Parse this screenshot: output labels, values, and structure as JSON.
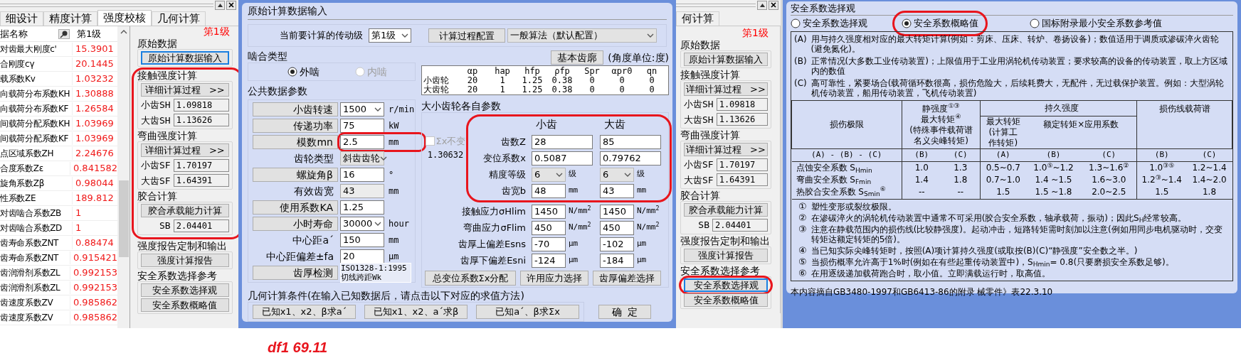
{
  "strength_panel": {
    "tabs": [
      {
        "label": "细设计",
        "selected": false
      },
      {
        "label": "精度计算",
        "selected": false
      },
      {
        "label": "强度校核",
        "selected": true
      },
      {
        "label": "几何计算",
        "selected": false
      }
    ],
    "table": {
      "columns": [
        "据名称",
        "第1级"
      ],
      "rows": [
        {
          "name": "对齿最大刚度c'",
          "value": "15.3901"
        },
        {
          "name": "合刚度cγ",
          "value": "20.1445"
        },
        {
          "name": "载系数Kv",
          "value": "1.03232"
        },
        {
          "name": "向载荷分布系数KH",
          "value": "1.30888"
        },
        {
          "name": "向载荷分布系数KF",
          "value": "1.26584"
        },
        {
          "name": "间载荷分配系数KH",
          "value": "1.03969"
        },
        {
          "name": "间载荷分配系数KF",
          "value": "1.03969"
        },
        {
          "name": "点区域系数ZH",
          "value": "2.24676"
        },
        {
          "name": "合度系数Zε",
          "value": "0.841582"
        },
        {
          "name": "旋角系数Zβ",
          "value": "0.98044"
        },
        {
          "name": "性系数ZE",
          "value": "189.812"
        },
        {
          "name": "对齿啮合系数ZB",
          "value": "1"
        },
        {
          "name": "对齿啮合系数ZD",
          "value": "1"
        },
        {
          "name": "齿寿命系数ZNT",
          "value": "0.88474"
        },
        {
          "name": "齿寿命系数ZNT",
          "value": "0.915421"
        },
        {
          "name": "齿润滑剂系数ZL",
          "value": "0.992153"
        },
        {
          "name": "齿润滑剂系数ZL",
          "value": "0.992153"
        },
        {
          "name": "齿速度系数ZV",
          "value": "0.985862"
        },
        {
          "name": "齿速度系数ZV",
          "value": "0.985862"
        }
      ]
    },
    "level": "第1级",
    "groups": [
      {
        "title": "原始数据",
        "highlighted": false,
        "items": [
          {
            "kind": "button",
            "label": "原始计算数据输入",
            "focused": true,
            "highlighted": false
          }
        ]
      },
      {
        "title": "接触强度计算",
        "highlighted": true,
        "items": [
          {
            "kind": "button",
            "label": "详细计算过程",
            "suffix": ">>",
            "focused": false,
            "highlighted": false
          },
          {
            "kind": "field",
            "label": "小齿SH",
            "value": "1.09818"
          },
          {
            "kind": "field",
            "label": "大齿SH",
            "value": "1.13626"
          }
        ]
      },
      {
        "title": "弯曲强度计算",
        "highlighted": true,
        "items": [
          {
            "kind": "button",
            "label": "详细计算过程",
            "suffix": ">>",
            "focused": false,
            "highlighted": false
          },
          {
            "kind": "field",
            "label": "小齿SF",
            "value": "1.70197"
          },
          {
            "kind": "field",
            "label": "大齿SF",
            "value": "1.64391"
          }
        ]
      },
      {
        "title": "胶合计算",
        "highlighted": true,
        "items": [
          {
            "kind": "button",
            "label": "胶合承载能力计算",
            "focused": false,
            "highlighted": false
          },
          {
            "kind": "field",
            "label": "SB",
            "value": "2.04401"
          }
        ]
      },
      {
        "title": "强度报告定制和输出",
        "highlighted": false,
        "items": [
          {
            "kind": "button",
            "label": "强度计算报告",
            "focused": false,
            "highlighted": false
          }
        ]
      },
      {
        "title": "安全系数选择参考",
        "highlighted": false,
        "items": [
          {
            "kind": "button",
            "label": "安全系数选择观",
            "focused": false,
            "highlighted": false
          },
          {
            "kind": "button",
            "label": "安全系数概略值",
            "focused": false,
            "highlighted": false
          }
        ]
      }
    ]
  },
  "data_dialog": {
    "title": "原始计算数据输入",
    "stage": {
      "label": "当前要计算的传动级",
      "value": "第1级"
    },
    "config": {
      "button": "计算过程配置",
      "value": "一般算法（默认配置）"
    },
    "mesh": {
      "title": "啮合类型",
      "options": [
        {
          "label": "外啮",
          "selected": true,
          "disabled": false
        },
        {
          "label": "内啮",
          "selected": false,
          "disabled": true
        }
      ]
    },
    "common": {
      "title": "公共数据参数",
      "rows": [
        {
          "kind": "button",
          "label": "小齿转速",
          "field": {
            "kind": "select",
            "value": "1500",
            "disabled": false
          },
          "unit": "r/min",
          "highlighted": false
        },
        {
          "kind": "button",
          "label": "传递功率",
          "field": {
            "kind": "input",
            "value": "75"
          },
          "unit": "kW",
          "highlighted": false
        },
        {
          "kind": "button",
          "label": "模数mn",
          "field": {
            "kind": "input",
            "value": "2.5"
          },
          "unit": "mm",
          "highlighted": true
        },
        {
          "kind": "text",
          "label": "齿轮类型",
          "field": {
            "kind": "select",
            "value": "斜齿齿轮",
            "disabled": true
          },
          "highlighted": false
        },
        {
          "kind": "button",
          "label": "螺旋角β",
          "field": {
            "kind": "input",
            "value": "16"
          },
          "unit": "°",
          "highlighted": false
        },
        {
          "kind": "text",
          "label": "有效齿宽",
          "field": {
            "kind": "readonly",
            "value": "43"
          },
          "unit": "mm",
          "highlighted": false
        },
        {
          "kind": "button",
          "label": "使用系数KA",
          "field": {
            "kind": "input",
            "value": "1.25"
          },
          "highlighted": false
        },
        {
          "kind": "button",
          "label": "小时寿命",
          "field": {
            "kind": "select",
            "value": "30000",
            "disabled": false
          },
          "unit": "hour",
          "highlighted": false
        },
        {
          "kind": "text",
          "label": "中心距a´",
          "field": {
            "kind": "input",
            "value": "150"
          },
          "unit": "mm",
          "highlighted": false
        },
        {
          "kind": "text",
          "label": "中心距偏差±fa",
          "field": {
            "kind": "input",
            "value": "20"
          },
          "unit": "μm",
          "highlighted": false
        },
        {
          "kind": "button",
          "label": "齿厚检测",
          "field": {
            "kind": "memo",
            "value": "ISO1328-1:1995\n切线跨距Wk"
          },
          "highlighted": false
        }
      ]
    },
    "profile": {
      "button": "基本齿廓",
      "caption": "(角度单位:度)",
      "columns": [
        "",
        "αp",
        "hap",
        "hfp",
        "ρfp",
        "Spr",
        "αpr0",
        "qn"
      ],
      "rows": [
        [
          "小齿轮",
          "20",
          "1",
          "1.25",
          "0.38",
          "0",
          "0",
          "0"
        ],
        [
          "大齿轮",
          "20",
          "1",
          "1.25",
          "0.38",
          "0",
          "0",
          "0"
        ]
      ]
    },
    "gears": {
      "title": "大小齿轮各自参数",
      "highlighted": true,
      "lock": {
        "label": "Σx不变",
        "checked": false,
        "disabled": true
      },
      "sum": "1.30632",
      "columns": [
        "小齿",
        "大齿"
      ],
      "rows": [
        {
          "label": "齿数Z",
          "cells": [
            {
              "kind": "input",
              "value": "28"
            },
            {
              "kind": "input",
              "value": "85"
            }
          ]
        },
        {
          "label": "变位系数x",
          "cells": [
            {
              "kind": "input",
              "value": "0.5087"
            },
            {
              "kind": "input",
              "value": "0.79762"
            }
          ]
        },
        {
          "label": "精度等级",
          "cells": [
            {
              "kind": "select",
              "value": "6",
              "disabled": true,
              "unit": "级"
            },
            {
              "kind": "select",
              "value": "6",
              "disabled": true,
              "unit": "级"
            }
          ]
        },
        {
          "label": "齿宽b",
          "cells": [
            {
              "kind": "input",
              "value": "48",
              "unit": "mm"
            },
            {
              "kind": "input",
              "value": "43",
              "unit": "mm"
            }
          ]
        }
      ],
      "limit_rows": [
        {
          "label": "接触应力σHlim",
          "cells": [
            {
              "kind": "input",
              "value": "1450",
              "unit": "N/mm$^{2}$"
            },
            {
              "kind": "input",
              "value": "1450",
              "unit": "N/mm$^{2}$"
            }
          ]
        },
        {
          "label": "弯曲应力σFlim",
          "cells": [
            {
              "kind": "input",
              "value": "450",
              "unit": "N/mm$^{2}$"
            },
            {
              "kind": "input",
              "value": "450",
              "unit": "N/mm$^{2}$"
            }
          ]
        },
        {
          "label": "齿厚上偏差Esns",
          "cells": [
            {
              "kind": "input",
              "value": "-70",
              "unit": "μm"
            },
            {
              "kind": "input",
              "value": "-102",
              "unit": "μm"
            }
          ]
        },
        {
          "label": "齿厚下偏差Esni",
          "cells": [
            {
              "kind": "input",
              "value": "-124",
              "unit": "μm"
            },
            {
              "kind": "input",
              "value": "-184",
              "unit": "μm"
            }
          ]
        }
      ],
      "buttons": [
        "总变位系数Σx分配",
        "许用应力选择",
        "齿厚偏差选择"
      ]
    },
    "geometry": {
      "title": "几何计算条件(在输入已知数据后，请点击以下对应的求值方法)",
      "buttons": [
        "已知x1、x2、β求a´",
        "已知x1、x2、a´求β",
        "已知a´、β求Σx"
      ]
    },
    "ok": "确  定"
  },
  "side_panel_copy": {
    "tabs": [
      {
        "label": "何计算",
        "selected": false
      }
    ],
    "level": "第1级",
    "groups": [
      {
        "title": "原始数据",
        "highlighted": false,
        "items": [
          {
            "kind": "button",
            "label": "原始计算数据输入",
            "focused": false,
            "highlighted": false
          }
        ]
      },
      {
        "title": "接触强度计算",
        "highlighted": false,
        "items": [
          {
            "kind": "button",
            "label": "详细计算过程",
            "suffix": ">>",
            "focused": false,
            "highlighted": false
          },
          {
            "kind": "field",
            "label": "小齿SH",
            "value": "1.09818"
          },
          {
            "kind": "field",
            "label": "大齿SH",
            "value": "1.13626"
          }
        ]
      },
      {
        "title": "弯曲强度计算",
        "highlighted": false,
        "items": [
          {
            "kind": "button",
            "label": "详细计算过程",
            "suffix": ">>",
            "focused": false,
            "highlighted": false
          },
          {
            "kind": "field",
            "label": "小齿SF",
            "value": "1.70197"
          },
          {
            "kind": "field",
            "label": "大齿SF",
            "value": "1.64391"
          }
        ]
      },
      {
        "title": "胶合计算",
        "highlighted": false,
        "items": [
          {
            "kind": "button",
            "label": "胶合承载能力计算",
            "focused": false,
            "highlighted": false
          },
          {
            "kind": "field",
            "label": "SB",
            "value": "2.04401"
          }
        ]
      },
      {
        "title": "强度报告定制和输出",
        "highlighted": false,
        "items": [
          {
            "kind": "button",
            "label": "强度计算报告",
            "focused": false,
            "highlighted": false
          }
        ]
      },
      {
        "title": "安全系数选择参考",
        "highlighted": false,
        "items": [
          {
            "kind": "button",
            "label": "安全系数选择观",
            "focused": true,
            "highlighted": true
          },
          {
            "kind": "button",
            "label": "安全系数概略值",
            "focused": false,
            "highlighted": false
          }
        ]
      }
    ]
  },
  "safety_dialog": {
    "title": "安全系数选择观",
    "modes": [
      {
        "label": "安全系数选择观",
        "selected": false,
        "highlighted": false
      },
      {
        "label": "安全系数概略值",
        "selected": true,
        "highlighted": true
      },
      {
        "label": "国标附录最小安全系数参考值",
        "selected": false,
        "highlighted": false
      }
    ],
    "notes": [
      {
        "mark": "(A)",
        "text": "用与持久强度相对应的最大转矩计算(例如：剪床、压床、转炉、卷扬设备)；数值适用于调质或渗碳淬火齿轮(避免氮化)。"
      },
      {
        "mark": "(B)",
        "text": "正常情况(大多数工业传动装置)；上限值用于工业用涡轮机传动装置；要求较高的设备的传动装置，取上方区域内的数值"
      },
      {
        "mark": "(C)",
        "text": "高可靠性，紧要场合(载荷循环数很高，损伤危险大，后续耗费大，无配件，无过载保护装置。例如：大型涡轮机传动装置，船用传动装置，飞机传动装置)"
      }
    ],
    "table": {
      "head": [
        {
          "lines": [
            "损伤极限"
          ]
        },
        {
          "lines": [
            "静强度$^{①③}$",
            "最大转矩$^{④}$",
            "(特殊事件载荷谱名义尖峰转矩)"
          ]
        },
        {
          "lines": [
            "持久强度"
          ]
        },
        {
          "lines": [
            "损伤线载荷谱"
          ]
        }
      ],
      "subhead": [
        {
          "lines": [
            "最大转矩",
            "(计算工作转矩)"
          ]
        },
        {
          "lines": [
            "额定转矩×应用系数"
          ]
        }
      ],
      "case_row": [
        "(A) - (B) - (C)",
        "(B)",
        "(C)",
        "(A)",
        "(B)",
        "(C)",
        "(B)",
        "(C)"
      ],
      "rows": [
        [
          "点蚀安全系数 S$_{Hmin}$",
          "1.0",
          "1.3",
          "0.5~0.7",
          "1.0$^{⑤}$~1.2",
          "1.3~1.6$^{②}$",
          "1.0$^{③⑤}$",
          "1.2~1.4"
        ],
        [
          "弯曲安全系数 S$_{Fmin}$",
          "1.4",
          "1.8",
          "0.7~1.0",
          "1.4 ~1.5",
          "1.6~3.0",
          "1.2$^{③}$~1.4",
          "1.4~2.0"
        ],
        [
          "热胶合安全系数 S$_{Smin}$$^{⑥}$",
          "--",
          "--",
          "1.5",
          "1.5 ~1.8",
          "2.0~2.5",
          "1.5",
          "1.8"
        ]
      ]
    },
    "footnotes": [
      {
        "mark": "①",
        "text": "塑性变形或裂纹极限。"
      },
      {
        "mark": "②",
        "text": "在渗碳淬火的涡轮机传动装置中通常不可采用(胶合安全系数，轴承载荷，振动)；因此S$_{H}$经常较高。"
      },
      {
        "mark": "③",
        "text": "注意在静载范围内的损伤线(比较静强度)。起动冲击，短路转矩需时刻加以注意(例如用同步电机驱动时，交变转矩达额定转矩的5倍)。"
      },
      {
        "mark": "④",
        "text": "当已知实际尖峰转矩时，按照(A)项计算持久强度(或取按(B)(C)“静强度”安全数之半。)"
      },
      {
        "mark": "⑤",
        "text": "当损伤概率允许高于1%时(例如在有些起重传动装置中)，S$_{Hmin}$= 0.8(只要磨损安全系数足够)。"
      },
      {
        "mark": "⑥",
        "text": "在用逐级递加载荷跑合时，取小值。立即满载运行时，取高值。"
      }
    ],
    "source": "本内容摘自GB3480-1997和GB6413-86的附录 械零件》表22.3.10"
  },
  "note": "df1 69.11"
}
